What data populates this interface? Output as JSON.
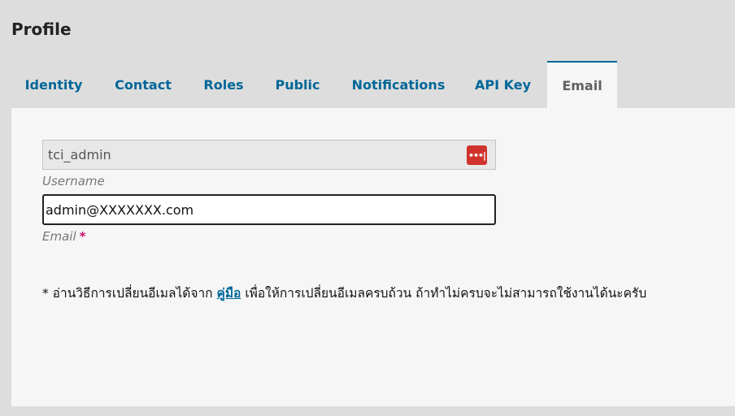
{
  "header": {
    "title": "Profile"
  },
  "tabs": [
    {
      "label": "Identity"
    },
    {
      "label": "Contact"
    },
    {
      "label": "Roles"
    },
    {
      "label": "Public"
    },
    {
      "label": "Notifications"
    },
    {
      "label": "API Key"
    },
    {
      "label": "Email",
      "active": true
    }
  ],
  "form": {
    "username": {
      "value": "tci_admin",
      "label": "Username"
    },
    "email": {
      "value": "admin@XXXXXXX.com",
      "label": "Email",
      "required_mark": "*"
    }
  },
  "note": {
    "prefix": "* อ่านวิธีการเปลี่ยนอีเมลได้จาก",
    "link_text": "คู่มือ",
    "suffix": "เพื่อให้การเปลี่ยนอีเมลครบถ้วน ถ้าทำไม่ครบจะไม่สามารถใช้งานได้นะครับ"
  },
  "icons": {
    "password_manager": "password-dots-icon"
  },
  "colors": {
    "link": "#006798",
    "required": "#d00f6b",
    "icon_bg": "#d0332b"
  }
}
